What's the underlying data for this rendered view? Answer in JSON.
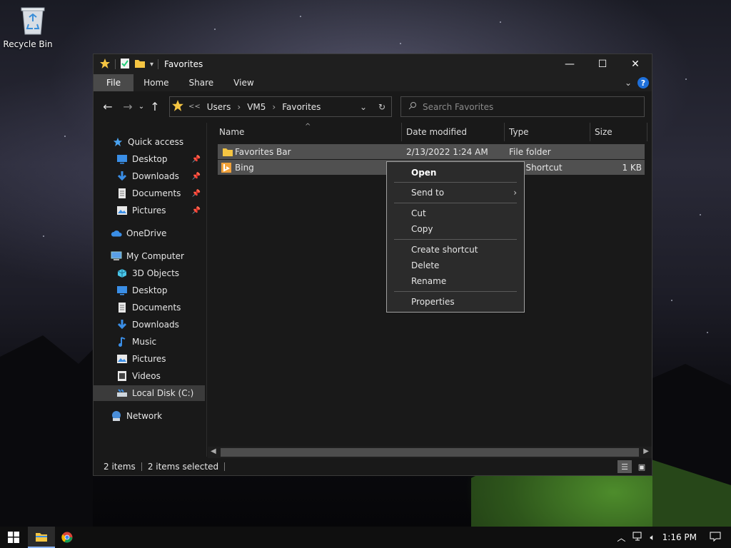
{
  "desktop": {
    "recycle_bin_label": "Recycle Bin"
  },
  "window": {
    "title": "Favorites",
    "ribbon_tabs": [
      "File",
      "Home",
      "Share",
      "View"
    ],
    "help_glyph": "?",
    "address": {
      "prefix": "<<",
      "crumbs": [
        "Users",
        "VM5",
        "Favorites"
      ]
    },
    "search_placeholder": "Search Favorites",
    "nav_pane": {
      "quick_access": "Quick access",
      "quick_items": [
        "Desktop",
        "Downloads",
        "Documents",
        "Pictures"
      ],
      "onedrive": "OneDrive",
      "computer": "My Computer",
      "computer_items": [
        "3D Objects",
        "Desktop",
        "Documents",
        "Downloads",
        "Music",
        "Pictures",
        "Videos",
        "Local Disk (C:)"
      ],
      "network": "Network",
      "selected": "Local Disk (C:)"
    },
    "columns": [
      "Name",
      "Date modified",
      "Type",
      "Size"
    ],
    "files": [
      {
        "name": "Favorites Bar",
        "date": "2/13/2022 1:24 AM",
        "type": "File folder",
        "size": ""
      },
      {
        "name": "Bing",
        "date": "",
        "type": "net Shortcut",
        "size": "1 KB"
      }
    ],
    "status": {
      "items": "2 items",
      "selected": "2 items selected"
    }
  },
  "context_menu": {
    "open": "Open",
    "send_to": "Send to",
    "cut": "Cut",
    "copy": "Copy",
    "create_shortcut": "Create shortcut",
    "delete": "Delete",
    "rename": "Rename",
    "properties": "Properties"
  },
  "taskbar": {
    "clock": "1:16 PM"
  },
  "colors": {
    "accent": "#1e6fd9",
    "folder": "#f5c542",
    "selection": "#505050"
  }
}
